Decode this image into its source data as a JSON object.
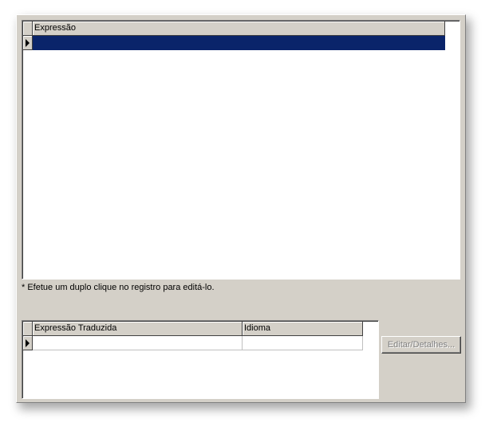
{
  "top_grid": {
    "columns": [
      {
        "label": "Expressão"
      }
    ],
    "rows": [
      {
        "cells": [
          ""
        ],
        "selected": true
      }
    ]
  },
  "hint_text": "* Efetue um duplo clique no registro para editá-lo.",
  "bottom_grid": {
    "columns": [
      {
        "label": "Expressão Traduzida"
      },
      {
        "label": "Idioma"
      }
    ],
    "rows": [
      {
        "cells": [
          "",
          ""
        ],
        "selected": false
      }
    ]
  },
  "edit_button": {
    "label": "Editar/Detalhes...",
    "enabled": false
  },
  "colors": {
    "panel": "#d4d0c8",
    "selection": "#0a246a",
    "disabled_text": "#808080"
  }
}
